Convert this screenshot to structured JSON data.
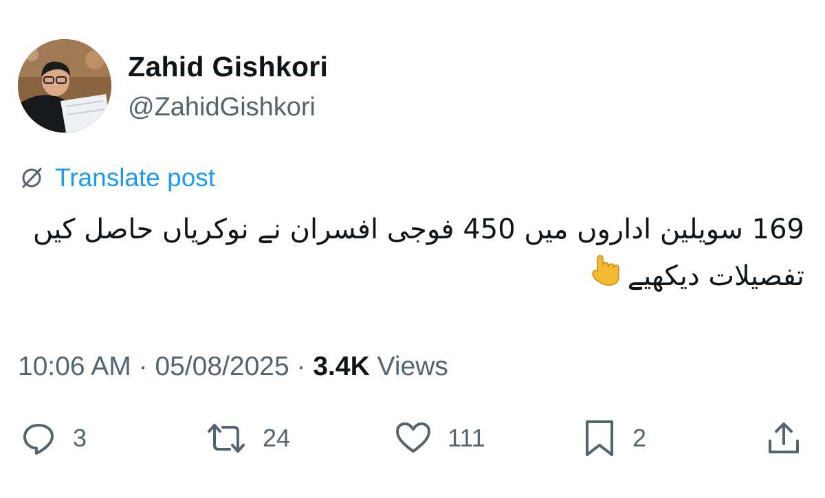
{
  "author": {
    "display_name": "Zahid Gishkori",
    "handle": "@ZahidGishkori"
  },
  "translate": {
    "label": "Translate post",
    "icon": "translate-icon"
  },
  "post": {
    "line1": "169 سویلین اداروں میں 450 فوجی افسران نے نوکریاں حاصل کیں",
    "line2": "تفصیلات دیکھیے",
    "emoji": "👇"
  },
  "meta": {
    "time": "10:06 AM",
    "separator": "·",
    "date": "05/08/2025",
    "views_count": "3.4K",
    "views_label": "Views"
  },
  "actions": {
    "replies": "3",
    "reposts": "24",
    "likes": "111",
    "bookmarks": "2"
  },
  "colors": {
    "text": "#0f1419",
    "secondary": "#536471",
    "accent": "#1d9bf0"
  }
}
